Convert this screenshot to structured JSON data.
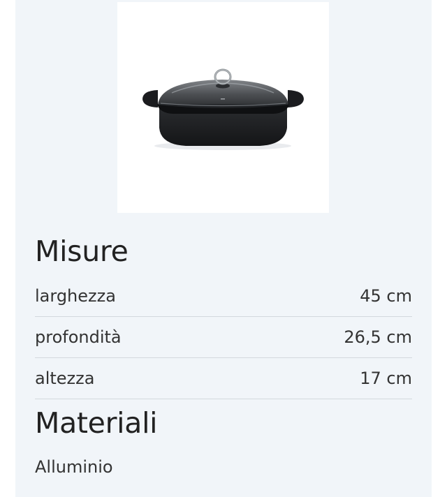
{
  "product": {
    "image_icon": "casserole-with-glass-lid"
  },
  "misure": {
    "title": "Misure",
    "rows": [
      {
        "label": "larghezza",
        "value": "45 cm"
      },
      {
        "label": "profondità",
        "value": "26,5 cm"
      },
      {
        "label": "altezza",
        "value": "17 cm"
      }
    ]
  },
  "materiali": {
    "title": "Materiali",
    "value": "Alluminio"
  },
  "colors": {
    "panel_background": "#f1f5f9",
    "divider": "#d3d8dd",
    "text": "#333333"
  }
}
